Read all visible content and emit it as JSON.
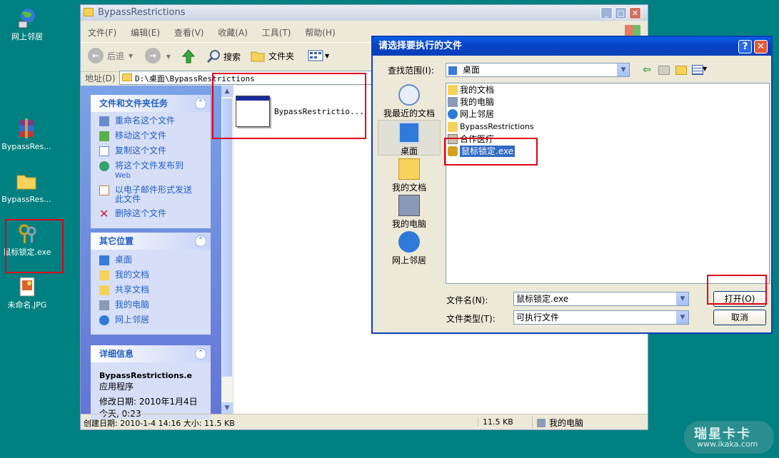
{
  "desktop": {
    "icons": [
      {
        "label": "网上邻居",
        "icon": "network-neighborhood-icon"
      },
      {
        "label": "BypassRes...",
        "icon": "winrar-archive-icon"
      },
      {
        "label": "BypassRes...",
        "icon": "folder-icon"
      },
      {
        "label": "鼠标锁定.exe",
        "icon": "keys-exe-icon"
      },
      {
        "label": "未命名.JPG",
        "icon": "jpg-image-icon"
      }
    ],
    "watermark": {
      "brand": "瑞星卡卡",
      "url": "www.ikaka.com"
    }
  },
  "explorer": {
    "title": "BypassRestrictions",
    "menu": [
      "文件(F)",
      "编辑(E)",
      "查看(V)",
      "收藏(A)",
      "工具(T)",
      "帮助(H)"
    ],
    "toolbar": {
      "back": "后退",
      "search": "搜索",
      "folders": "文件夹"
    },
    "address_label": "地址(D)",
    "address_value": "D:\\桌面\\BypassRestrictions",
    "file_tasks": {
      "title": "文件和文件夹任务",
      "items": [
        "重命名这个文件",
        "移动这个文件",
        "复制这个文件",
        "将这个文件发布到",
        "Web",
        "以电子邮件形式发送",
        "此文件",
        "删除这个文件"
      ]
    },
    "other_places": {
      "title": "其它位置",
      "items": [
        "桌面",
        "我的文档",
        "共享文档",
        "我的电脑",
        "网上邻居"
      ]
    },
    "details": {
      "title": "详细信息",
      "name": "BypassRestrictions.e",
      "type": "应用程序",
      "modified": "修改日期: 2010年1月4日",
      "modified2": "今天, 0:23"
    },
    "file": {
      "name": "BypassRestrictio..."
    },
    "status": {
      "created": "创建日期: 2010-1-4 14:16 大小: 11.5 KB",
      "size": "11.5 KB",
      "location": "我的电脑"
    }
  },
  "dialog": {
    "title": "请选择要执行的文件",
    "look_in_label": "查找范围(I):",
    "look_in_value": "桌面",
    "places": [
      "我最近的文档",
      "桌面",
      "我的文档",
      "我的电脑",
      "网上邻居"
    ],
    "files": [
      "我的文档",
      "我的电脑",
      "网上邻居",
      "BypassRestrictions",
      "合作医疗",
      "鼠标锁定.exe"
    ],
    "filename_label": "文件名(N):",
    "filename_value": "鼠标锁定.exe",
    "filetype_label": "文件类型(T):",
    "filetype_value": "可执行文件",
    "open_button": "打开(O)",
    "cancel_button": "取消"
  },
  "colors": {
    "desktop": "#008080",
    "xp_blue": "#0a4fd8",
    "highlight_red": "#e0001b",
    "task_blue": "#215dc6",
    "selection": "#316ac5"
  }
}
